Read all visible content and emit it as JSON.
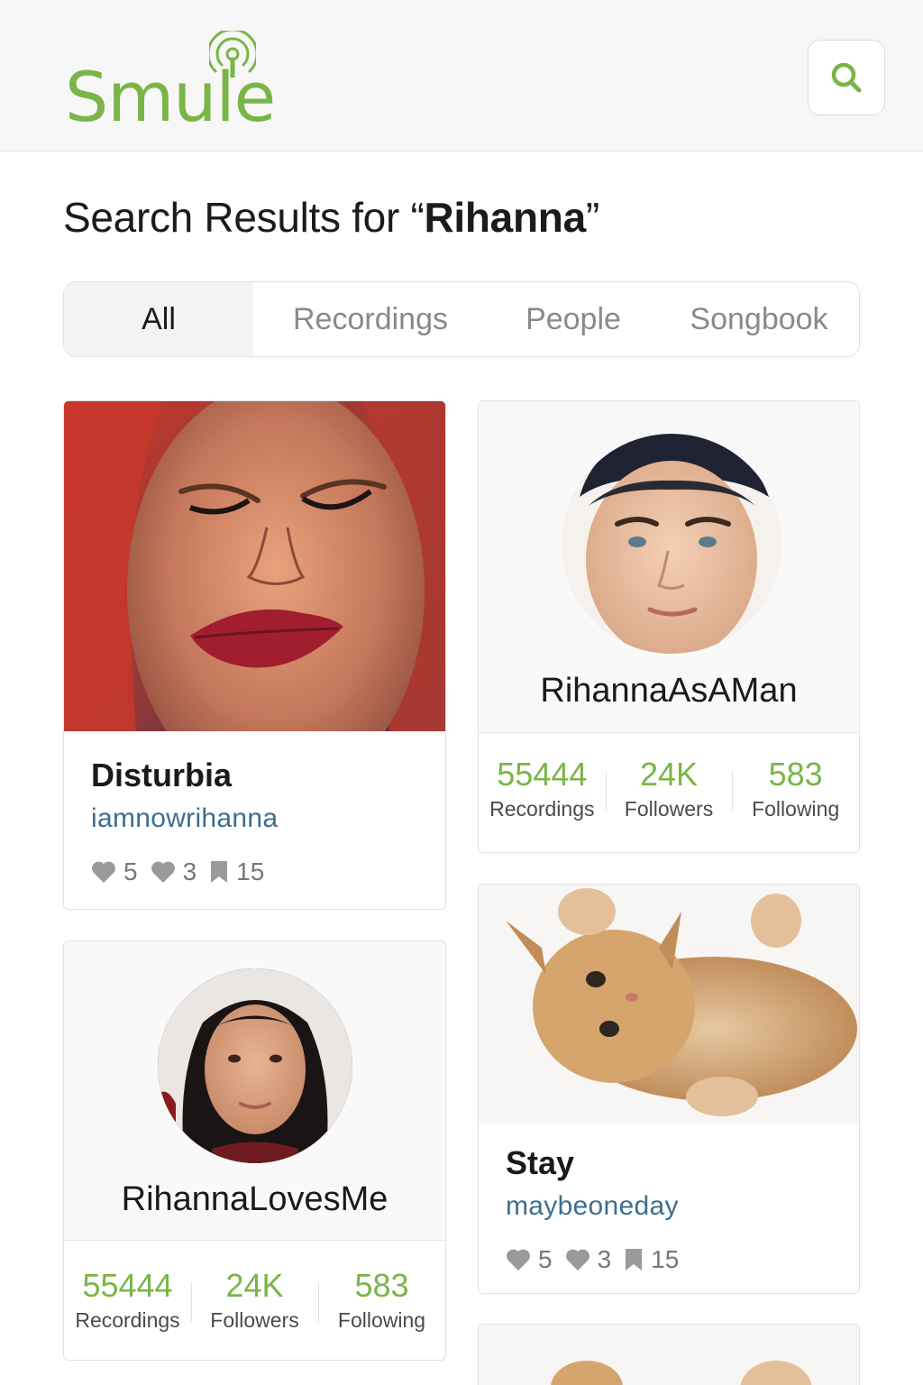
{
  "app": {
    "logo_text": "Smule"
  },
  "search": {
    "button_label": "Search"
  },
  "page": {
    "title_prefix": "Search Results for “",
    "query": "Rihanna",
    "title_suffix": "”"
  },
  "tabs": [
    {
      "label": "All",
      "active": true
    },
    {
      "label": "Recordings",
      "active": false
    },
    {
      "label": "People",
      "active": false
    },
    {
      "label": "Songbook",
      "active": false
    }
  ],
  "results": {
    "recording_1": {
      "title": "Disturbia",
      "user": "iamnowrihanna",
      "loves": "5",
      "comments": "3",
      "saves": "15"
    },
    "person_1": {
      "name": "RihannaAsAMan",
      "recordings": "55444",
      "recordings_label": "Recordings",
      "followers": "24K",
      "followers_label": "Followers",
      "following": "583",
      "following_label": "Following"
    },
    "person_2": {
      "name": "RihannaLovesMe",
      "recordings": "55444",
      "recordings_label": "Recordings",
      "followers": "24K",
      "followers_label": "Followers",
      "following": "583",
      "following_label": "Following"
    },
    "recording_2": {
      "title": "Stay",
      "user": "maybeoneday",
      "loves": "5",
      "comments": "3",
      "saves": "15"
    }
  },
  "colors": {
    "brand_green": "#7ab547",
    "link_blue": "#3e6e8e",
    "muted": "#8a8a8a"
  },
  "icons": [
    "antenna-icon",
    "search-icon",
    "heart-icon",
    "comment-heart-icon",
    "bookmark-icon"
  ]
}
